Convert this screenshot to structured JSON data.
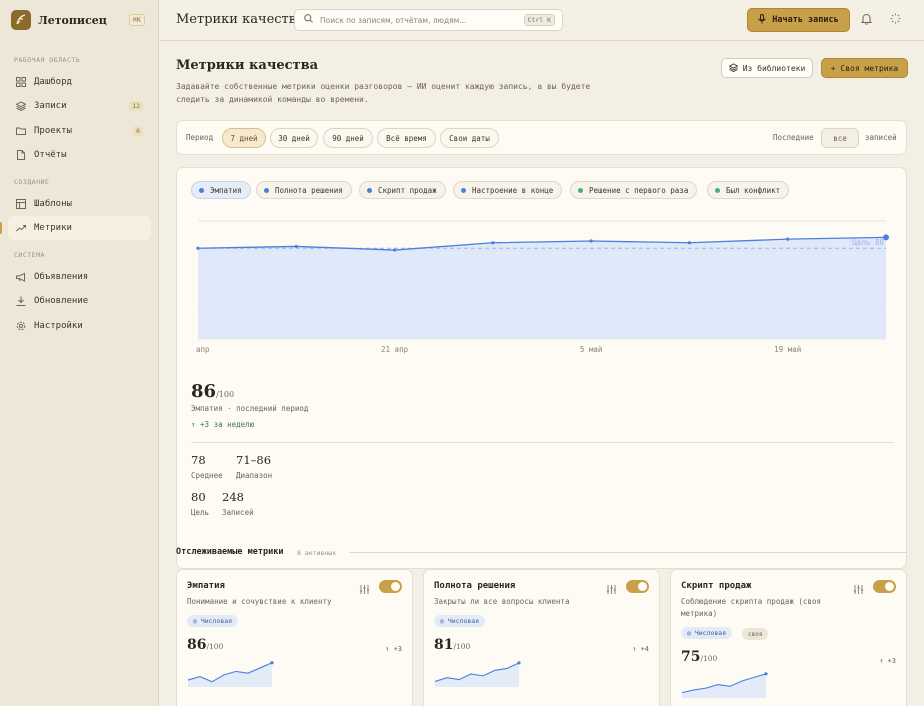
{
  "colors": {
    "accent": "#c9a04a",
    "line": "#4a7fe0",
    "fill": "#dbe5f9",
    "green": "#3fb47a"
  },
  "sidebar": {
    "brand": "Летописец",
    "brand_kbd": "⌘K",
    "sections": {
      "workspace": "РАБОЧАЯ ОБЛАСТЬ",
      "create": "СОЗДАНИЕ",
      "system": "СИСТЕМА"
    },
    "items": [
      {
        "label": "Дашборд",
        "icon": "grid-icon",
        "badge": ""
      },
      {
        "label": "Записи",
        "icon": "layers-icon",
        "badge": "12"
      },
      {
        "label": "Проекты",
        "icon": "folder-icon",
        "badge": "6"
      },
      {
        "label": "Отчёты",
        "icon": "file-icon",
        "badge": ""
      },
      {
        "label": "Шаблоны",
        "icon": "template-icon",
        "badge": ""
      },
      {
        "label": "Метрики",
        "icon": "trend-icon",
        "badge": ""
      },
      {
        "label": "Объявления",
        "icon": "megaphone-icon",
        "badge": ""
      },
      {
        "label": "Обновление",
        "icon": "download-icon",
        "badge": ""
      },
      {
        "label": "Настройки",
        "icon": "gear-icon",
        "badge": ""
      }
    ]
  },
  "topbar": {
    "title": "Метрики качества",
    "search_placeholder": "Поиск по записям, отчётам, людям...",
    "search_kbd": "Ctrl K",
    "record_label": "Начать запись"
  },
  "page": {
    "title": "Метрики качества",
    "description": "Задавайте собственные метрики оценки разговоров — ИИ оценит каждую запись, а вы будете следить за динамикой команды во времени.",
    "library_btn": "Из библиотеки",
    "own_btn": "+ Своя метрика"
  },
  "period": {
    "label": "Период",
    "options": [
      "7 дней",
      "30 дней",
      "90 дней",
      "Всё время",
      "Свои даты"
    ],
    "selected": "7 дней",
    "last_label": "Последние",
    "last_value": "все",
    "last_suffix": "записей"
  },
  "metric_chips": [
    {
      "label": "Эмпатия",
      "color": "#4a7fe0",
      "active": true
    },
    {
      "label": "Полнота решения",
      "color": "#4a7fe0",
      "active": false
    },
    {
      "label": "Скрипт продаж",
      "color": "#4a7fe0",
      "active": false
    },
    {
      "label": "Настроение в конце",
      "color": "#4a7fe0",
      "active": false
    },
    {
      "label": "Решение с первого раза",
      "color": "#3fb47a",
      "active": false
    },
    {
      "label": "Был конфликт",
      "color": "#3fb47a",
      "active": false
    }
  ],
  "chart_data": {
    "type": "area",
    "series": [
      {
        "name": "Эмпатия",
        "values": [
          80,
          81,
          79,
          83,
          84,
          83,
          85,
          86
        ]
      }
    ],
    "x": [
      "apr-7",
      "apr-14",
      "apr-21",
      "apr-28",
      "may-5",
      "may-12",
      "may-19",
      "may-26"
    ],
    "tick_labels": [
      "апр",
      "21 апр",
      "5 май",
      "19 май"
    ],
    "goal": 80,
    "goal_label": "Цель 80",
    "ylim": [
      30,
      95
    ],
    "grid": true
  },
  "summary": {
    "value": "86",
    "denominator": "/100",
    "label": "Эмпатия · последний период",
    "delta": "↑ +3 за неделю",
    "stats": [
      {
        "value": "78",
        "label": "Среднее"
      },
      {
        "value": "71–86",
        "label": "Диапазон"
      },
      {
        "value": "80",
        "label": "Цель"
      },
      {
        "value": "248",
        "label": "Записей"
      }
    ]
  },
  "tracked": {
    "title": "Отслеживаемые метрики",
    "count": "8 активных",
    "cards": [
      {
        "title": "Эмпатия",
        "desc": "Понимание и сочувствие к клиенту",
        "tag": "◎ Числовая",
        "tag2": "",
        "value": "86",
        "den": "/100",
        "delta": "↑ +3",
        "spark": [
          60,
          64,
          58,
          66,
          70,
          68,
          74,
          80
        ]
      },
      {
        "title": "Полнота решения",
        "desc": "Закрыты ли все вопросы клиента",
        "tag": "◎ Числовая",
        "tag2": "",
        "value": "81",
        "den": "/100",
        "delta": "↑ +4",
        "spark": [
          58,
          62,
          60,
          66,
          64,
          70,
          72,
          78
        ]
      },
      {
        "title": "Скрипт продаж",
        "desc": "Соблюдение скрипта продаж (своя метрика)",
        "tag": "◎ Числовая",
        "tag2": "своя",
        "value": "75",
        "den": "/100",
        "delta": "↑ +3",
        "spark": [
          55,
          58,
          60,
          64,
          62,
          68,
          72,
          76
        ]
      }
    ]
  }
}
